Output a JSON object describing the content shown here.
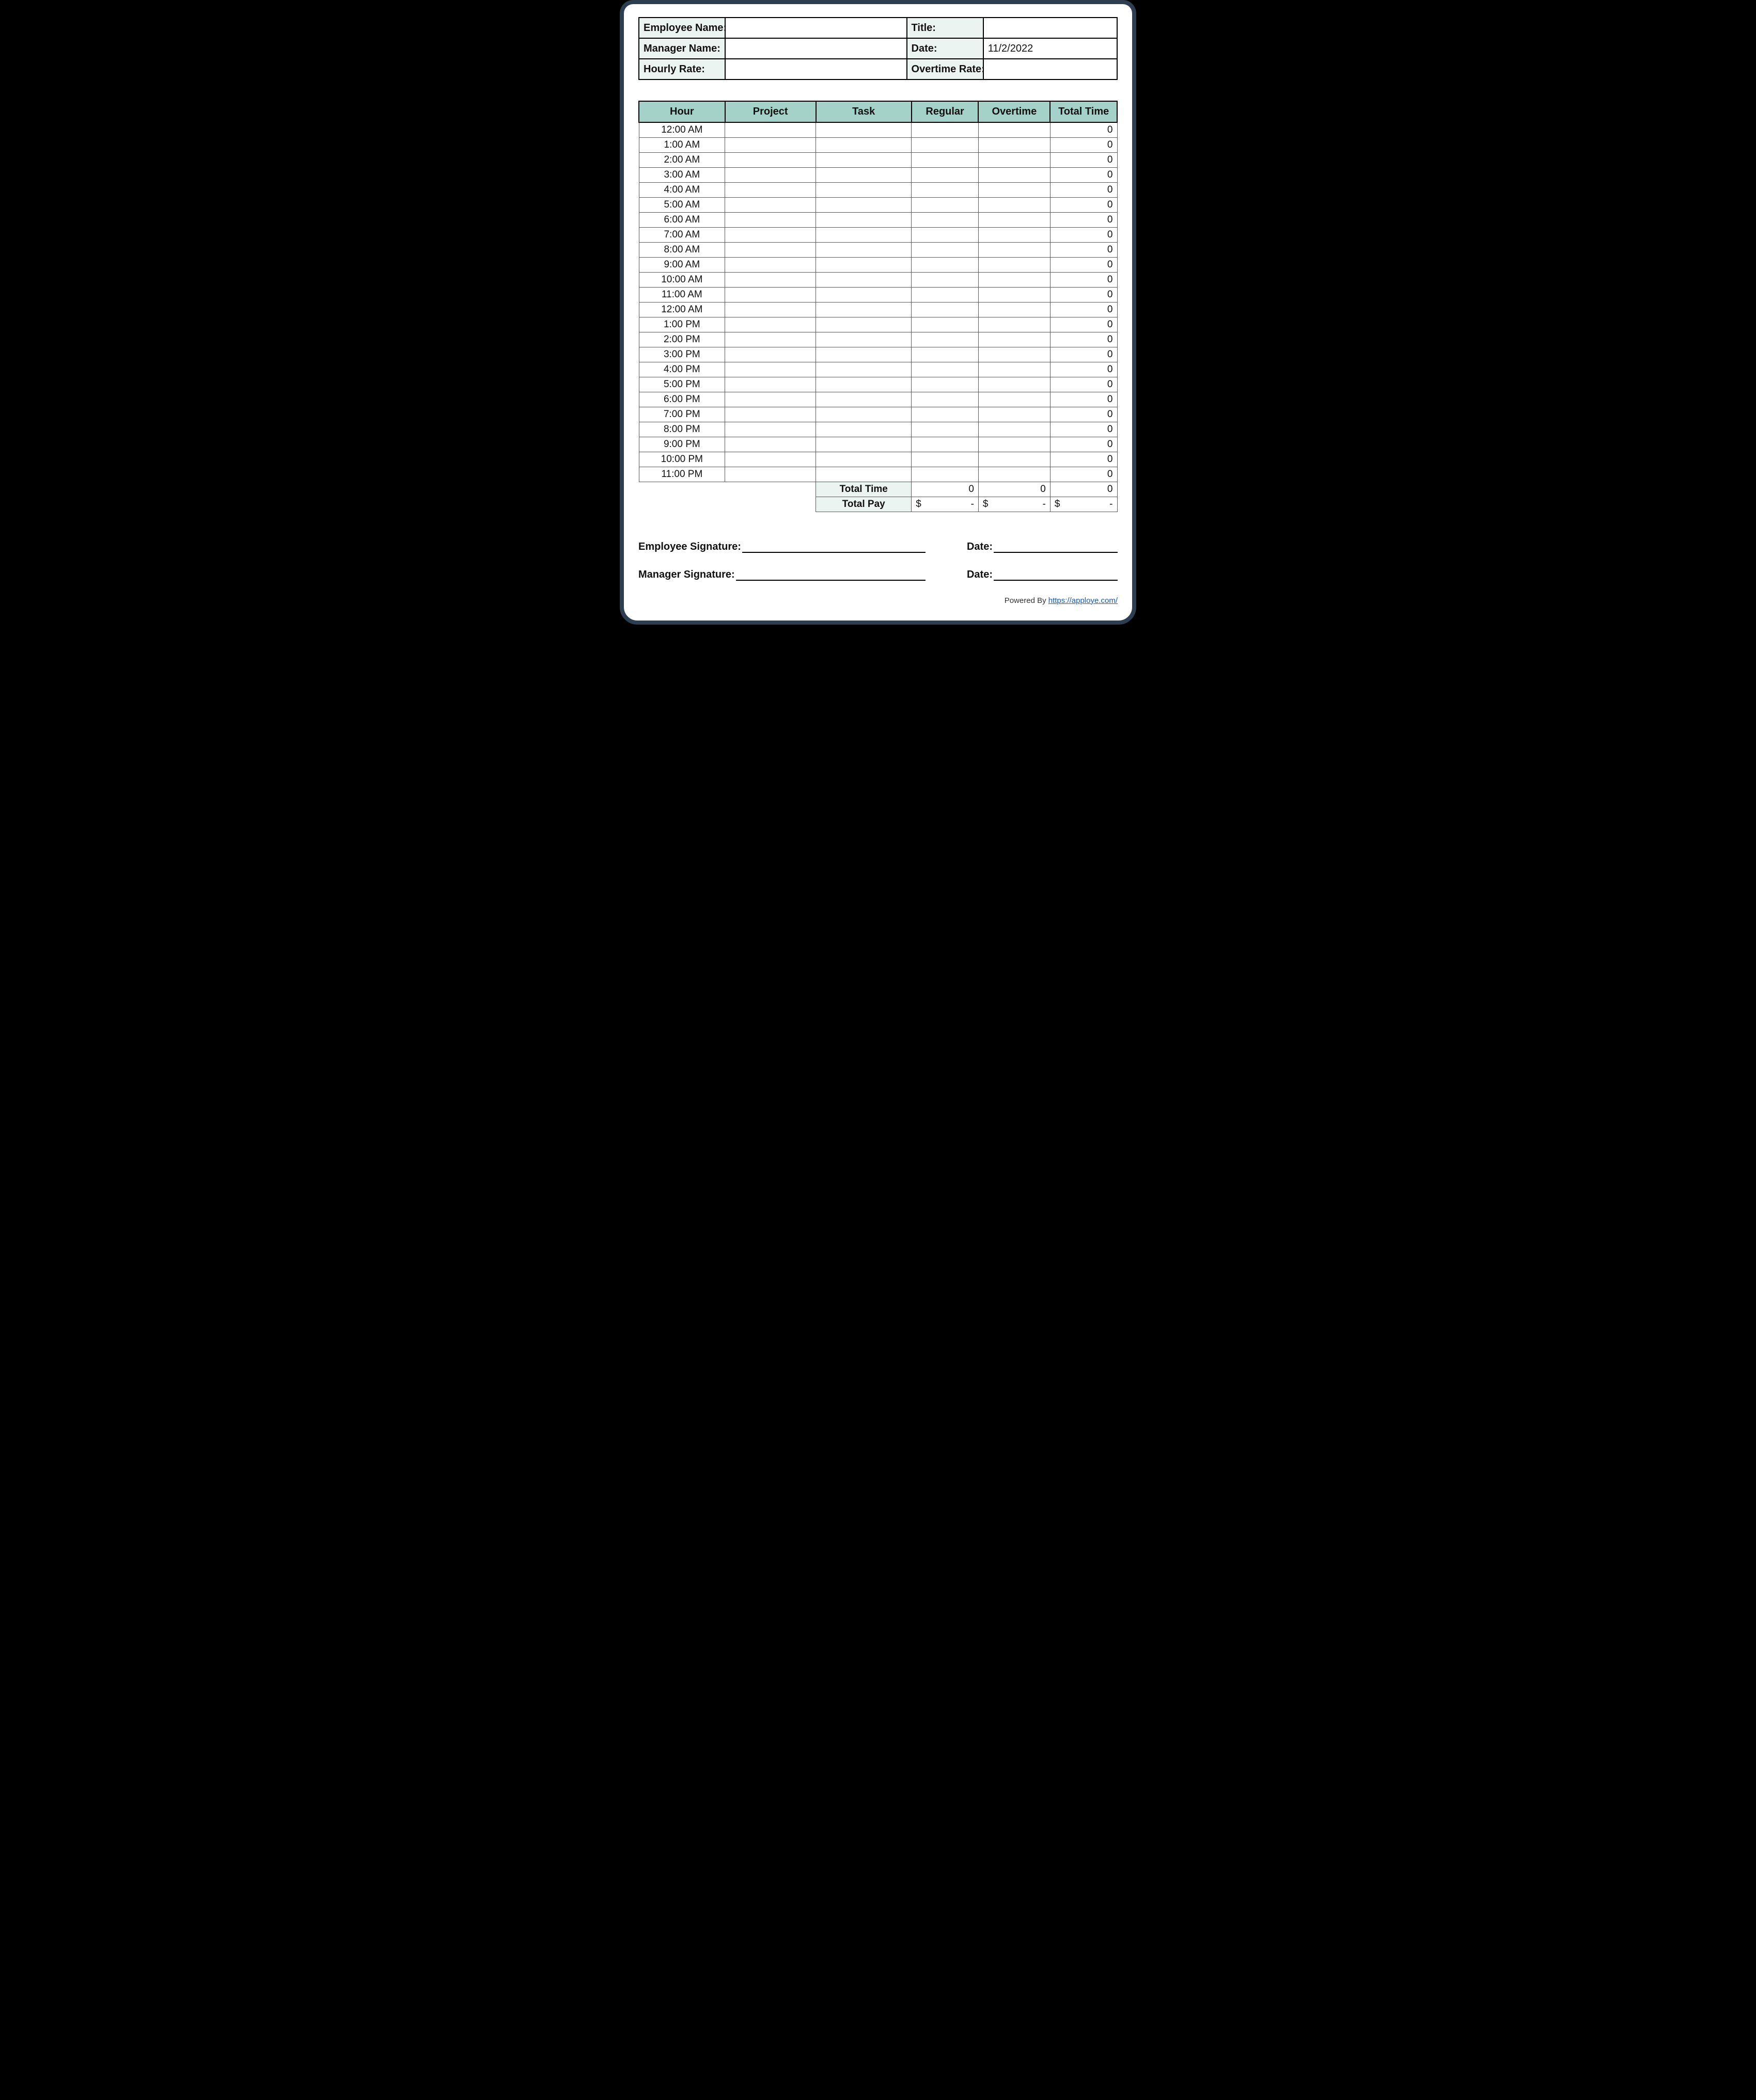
{
  "info": {
    "emp_name_label": "Employee Name:",
    "emp_name": "",
    "title_label": "Title:",
    "title": "",
    "mgr_name_label": "Manager Name:",
    "mgr_name": "",
    "date_label": "Date:",
    "date": "11/2/2022",
    "hrate_label": "Hourly Rate:",
    "hrate": "",
    "orate_label": "Overtime Rate:",
    "orate": ""
  },
  "grid": {
    "head": {
      "hour": "Hour",
      "project": "Project",
      "task": "Task",
      "regular": "Regular",
      "overtime": "Overtime",
      "total": "Total Time"
    },
    "rows": [
      {
        "hour": "12:00 AM",
        "project": "",
        "task": "",
        "regular": "",
        "overtime": "",
        "total": "0"
      },
      {
        "hour": "1:00 AM",
        "project": "",
        "task": "",
        "regular": "",
        "overtime": "",
        "total": "0"
      },
      {
        "hour": "2:00 AM",
        "project": "",
        "task": "",
        "regular": "",
        "overtime": "",
        "total": "0"
      },
      {
        "hour": "3:00 AM",
        "project": "",
        "task": "",
        "regular": "",
        "overtime": "",
        "total": "0"
      },
      {
        "hour": "4:00 AM",
        "project": "",
        "task": "",
        "regular": "",
        "overtime": "",
        "total": "0"
      },
      {
        "hour": "5:00 AM",
        "project": "",
        "task": "",
        "regular": "",
        "overtime": "",
        "total": "0"
      },
      {
        "hour": "6:00 AM",
        "project": "",
        "task": "",
        "regular": "",
        "overtime": "",
        "total": "0"
      },
      {
        "hour": "7:00 AM",
        "project": "",
        "task": "",
        "regular": "",
        "overtime": "",
        "total": "0"
      },
      {
        "hour": "8:00 AM",
        "project": "",
        "task": "",
        "regular": "",
        "overtime": "",
        "total": "0"
      },
      {
        "hour": "9:00 AM",
        "project": "",
        "task": "",
        "regular": "",
        "overtime": "",
        "total": "0"
      },
      {
        "hour": "10:00 AM",
        "project": "",
        "task": "",
        "regular": "",
        "overtime": "",
        "total": "0"
      },
      {
        "hour": "11:00 AM",
        "project": "",
        "task": "",
        "regular": "",
        "overtime": "",
        "total": "0"
      },
      {
        "hour": "12:00 AM",
        "project": "",
        "task": "",
        "regular": "",
        "overtime": "",
        "total": "0"
      },
      {
        "hour": "1:00 PM",
        "project": "",
        "task": "",
        "regular": "",
        "overtime": "",
        "total": "0"
      },
      {
        "hour": "2:00 PM",
        "project": "",
        "task": "",
        "regular": "",
        "overtime": "",
        "total": "0"
      },
      {
        "hour": "3:00 PM",
        "project": "",
        "task": "",
        "regular": "",
        "overtime": "",
        "total": "0"
      },
      {
        "hour": "4:00 PM",
        "project": "",
        "task": "",
        "regular": "",
        "overtime": "",
        "total": "0"
      },
      {
        "hour": "5:00 PM",
        "project": "",
        "task": "",
        "regular": "",
        "overtime": "",
        "total": "0"
      },
      {
        "hour": "6:00 PM",
        "project": "",
        "task": "",
        "regular": "",
        "overtime": "",
        "total": "0"
      },
      {
        "hour": "7:00 PM",
        "project": "",
        "task": "",
        "regular": "",
        "overtime": "",
        "total": "0"
      },
      {
        "hour": "8:00 PM",
        "project": "",
        "task": "",
        "regular": "",
        "overtime": "",
        "total": "0"
      },
      {
        "hour": "9:00 PM",
        "project": "",
        "task": "",
        "regular": "",
        "overtime": "",
        "total": "0"
      },
      {
        "hour": "10:00 PM",
        "project": "",
        "task": "",
        "regular": "",
        "overtime": "",
        "total": "0"
      },
      {
        "hour": "11:00 PM",
        "project": "",
        "task": "",
        "regular": "",
        "overtime": "",
        "total": "0"
      }
    ],
    "summary": {
      "time_label": "Total Time",
      "time_regular": "0",
      "time_overtime": "0",
      "time_total": "0",
      "pay_label": "Total Pay",
      "pay_regular_sym": "$",
      "pay_regular_val": "-",
      "pay_overtime_sym": "$",
      "pay_overtime_val": "-",
      "pay_total_sym": "$",
      "pay_total_val": "-"
    }
  },
  "sign": {
    "emp_label": "Employee Signature:",
    "mgr_label": "Manager Signature:",
    "date_label": "Date:"
  },
  "footer": {
    "prefix": "Powered By ",
    "link_text": "https://apploye.com/"
  }
}
